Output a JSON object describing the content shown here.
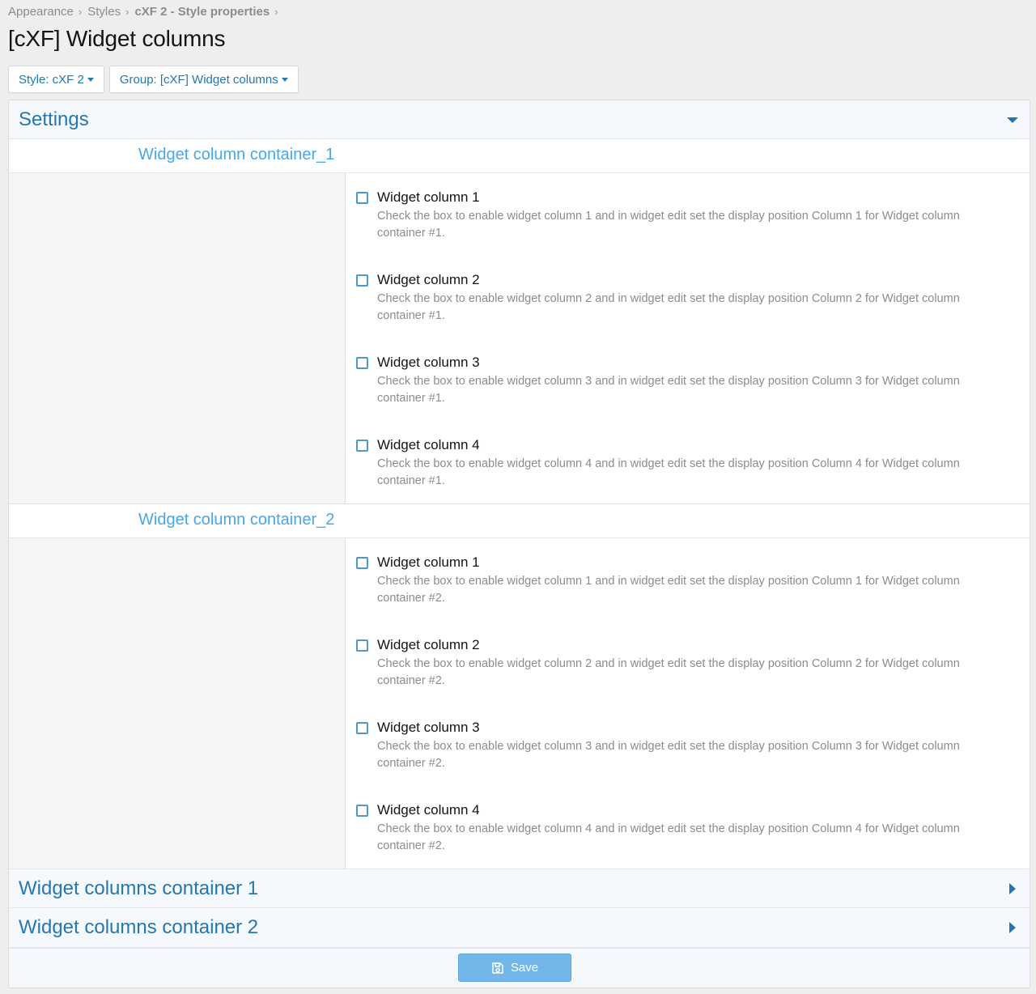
{
  "breadcrumb": [
    {
      "label": "Appearance"
    },
    {
      "label": "Styles"
    },
    {
      "label": "cXF 2 - Style properties"
    }
  ],
  "page_title": "[cXF] Widget columns",
  "filters": {
    "style_label": "Style: cXF 2",
    "group_label": "Group: [cXF] Widget columns"
  },
  "settings_header": "Settings",
  "groups": [
    {
      "title": "Widget column container_1",
      "options": [
        {
          "label": "Widget column 1",
          "hint": "Check the box to enable widget column 1 and in widget edit set the display position Column 1 for Widget column container #1.",
          "checked": false
        },
        {
          "label": "Widget column 2",
          "hint": "Check the box to enable widget column 2 and in widget edit set the display position Column 2 for Widget column container #1.",
          "checked": false
        },
        {
          "label": "Widget column 3",
          "hint": "Check the box to enable widget column 3 and in widget edit set the display position Column 3 for Widget column container #1.",
          "checked": false
        },
        {
          "label": "Widget column 4",
          "hint": "Check the box to enable widget column 4 and in widget edit set the display position Column 4 for Widget column container #1.",
          "checked": false
        }
      ]
    },
    {
      "title": "Widget column container_2",
      "options": [
        {
          "label": "Widget column 1",
          "hint": "Check the box to enable widget column 1 and in widget edit set the display position Column 1 for Widget column container #2.",
          "checked": false
        },
        {
          "label": "Widget column 2",
          "hint": "Check the box to enable widget column 2 and in widget edit set the display position Column 2 for Widget column container #2.",
          "checked": false
        },
        {
          "label": "Widget column 3",
          "hint": "Check the box to enable widget column 3 and in widget edit set the display position Column 3 for Widget column container #2.",
          "checked": false
        },
        {
          "label": "Widget column 4",
          "hint": "Check the box to enable widget column 4 and in widget edit set the display position Column 4 for Widget column container #2.",
          "checked": false
        }
      ]
    }
  ],
  "collapsed_sections": [
    {
      "title": "Widget columns container 1"
    },
    {
      "title": "Widget columns container 2"
    }
  ],
  "save_label": "Save",
  "colors": {
    "link": "#2577b1",
    "group_title": "#47a7eb",
    "save_button": "#73b6ea"
  },
  "icons": {
    "settings_toggle": "caret-down-icon",
    "collapsed_toggle": "caret-right-icon",
    "save": "save-icon"
  }
}
